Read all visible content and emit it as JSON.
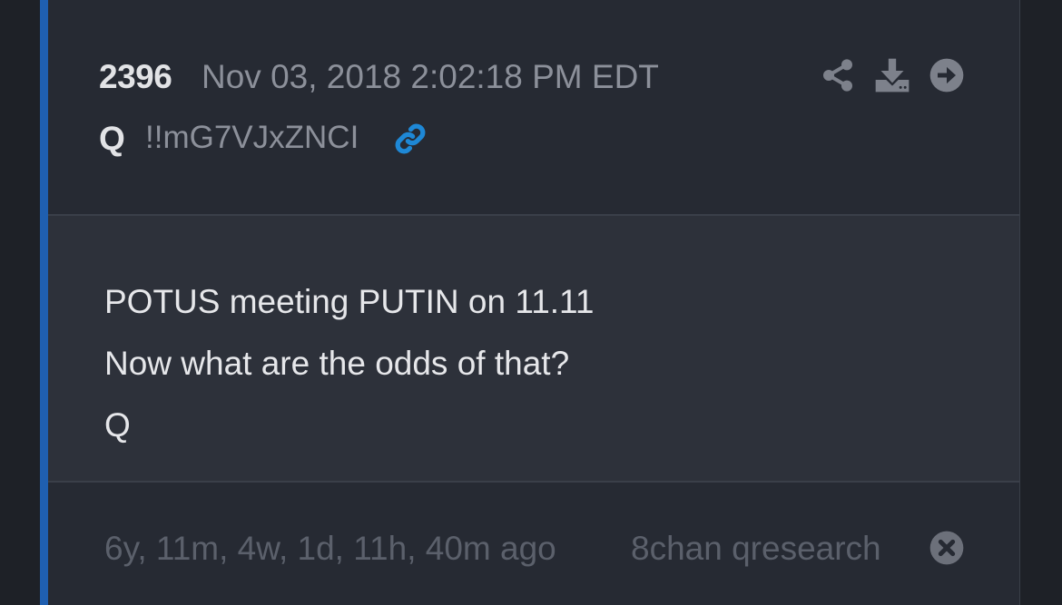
{
  "post": {
    "number": "2396",
    "date": "Nov 03, 2018 2:02:18 PM EDT",
    "author": "Q",
    "tripcode": "!!mG7VJxZNCI",
    "body_lines": [
      "POTUS meeting PUTIN on 11.11",
      "Now what are the odds of that?",
      "Q"
    ],
    "age": "6y, 11m, 4w, 1d, 11h, 40m ago",
    "source": "8chan qresearch"
  },
  "icons": {
    "link": "link-icon",
    "share": "share-icon",
    "download": "download-icon",
    "go": "arrow-right-circle-icon",
    "close": "close-circle-icon"
  },
  "colors": {
    "accent": "#1f5fb0",
    "link": "#1e88d6",
    "icon": "#8c909a",
    "faded_text": "#5b606b"
  }
}
